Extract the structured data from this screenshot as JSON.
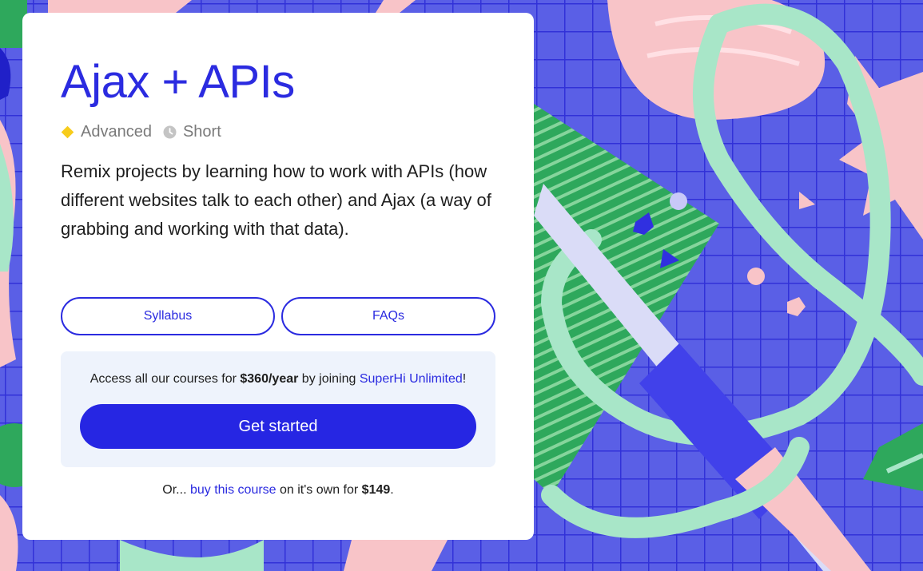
{
  "course": {
    "title": "Ajax + APIs",
    "level": "Advanced",
    "length": "Short",
    "description": "Remix projects by learning how to work with APIs (how different websites talk to each other) and Ajax (a way of grabbing and working with that data)."
  },
  "buttons": {
    "syllabus": "Syllabus",
    "faqs": "FAQs"
  },
  "promo": {
    "text_before": "Access all our courses for ",
    "price": "$360/year",
    "text_middle": " by joining ",
    "link": "SuperHi Unlimited",
    "text_after": "!",
    "cta": "Get started"
  },
  "footer": {
    "prefix": "Or... ",
    "link": "buy this course",
    "middle": " on it's own for ",
    "price": "$149",
    "suffix": "."
  },
  "icons": {
    "level": "diamond-icon",
    "length": "clock-icon"
  },
  "colors": {
    "brand_blue": "#2b2be0",
    "background_purple": "#5a5fe6",
    "mint": "#a8e6c8",
    "pink": "#f8c4c8",
    "green": "#2ea85c",
    "yellow": "#f7cc1c",
    "promo_bg": "#eef3fc"
  }
}
